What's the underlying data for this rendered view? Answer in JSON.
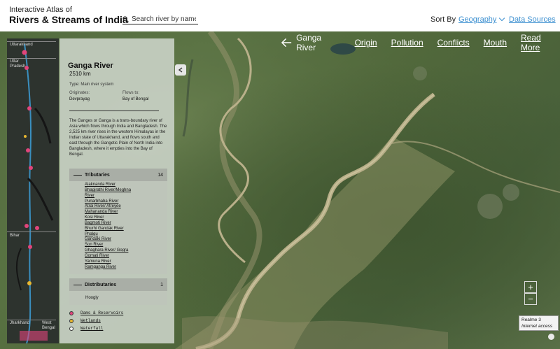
{
  "header": {
    "subtitle": "Interactive Atlas of",
    "title": "Rivers & Streams of India",
    "search_placeholder": "Search river by name",
    "sort_label": "Sort By",
    "sort_value": "Geography",
    "data_sources": "Data Sources"
  },
  "mapnav": {
    "river_name": "Ganga River",
    "links": [
      "Origin",
      "Pollution",
      "Conflicts",
      "Mouth",
      "Read More"
    ]
  },
  "strip": {
    "regions": [
      "Uttarakhand",
      "Uttar Pradesh",
      "Bihar",
      "Jharkhand",
      "West Bengal"
    ]
  },
  "panel": {
    "title": "Ganga River",
    "length": "2510 km",
    "type": "Type: Main river system",
    "originates_label": "Originates:",
    "originates_value": "Devprayag",
    "flows_label": "Flows to:",
    "flows_value": "Bay of Bengal",
    "description": "The Ganges or Ganga is a trans-boundary river of Asia which flows through India and Bangladesh. The 2,525 km river rises in the western Himalayas in the Indian state of Uttarakhand, and flows south and east through the Gangetic Plain of North India into Bangladesh, where it empties into the Bay of Bengal.",
    "tributaries_label": "Tributaries",
    "tributaries_count": "14",
    "tributaries": [
      "Alaknanda River",
      "Bhagirathi River/Meghna",
      "River",
      "Punarbhaba River",
      "Atrai River/ Atreyee",
      "Mahananda River",
      "Kosi River",
      "Bagmoti River",
      "Bhurhi Gandak River",
      "Phalgu",
      "Gandaki River",
      "Son River",
      "Ghaghara River/ Gogra",
      "Gomati River",
      "Yamuna River",
      "Ramganga River"
    ],
    "distributaries_label": "Distributaries",
    "distributaries_count": "1",
    "distributaries": [
      "Hoogly"
    ],
    "legend": [
      {
        "label": "Dams & Reservoirs",
        "color": "#e0457b"
      },
      {
        "label": "Wetlands",
        "color": "#e8b730"
      },
      {
        "label": "Waterfall",
        "color": "#f2f2f2"
      }
    ]
  },
  "zoom": {
    "in": "+",
    "out": "−"
  },
  "tooltip": {
    "line1": "Realme 3",
    "line2": "Internet access"
  },
  "colors": {
    "accent": "#3b8fd0",
    "river": "#45a6d8",
    "dam": "#e0457b",
    "wetland": "#e8b730"
  }
}
